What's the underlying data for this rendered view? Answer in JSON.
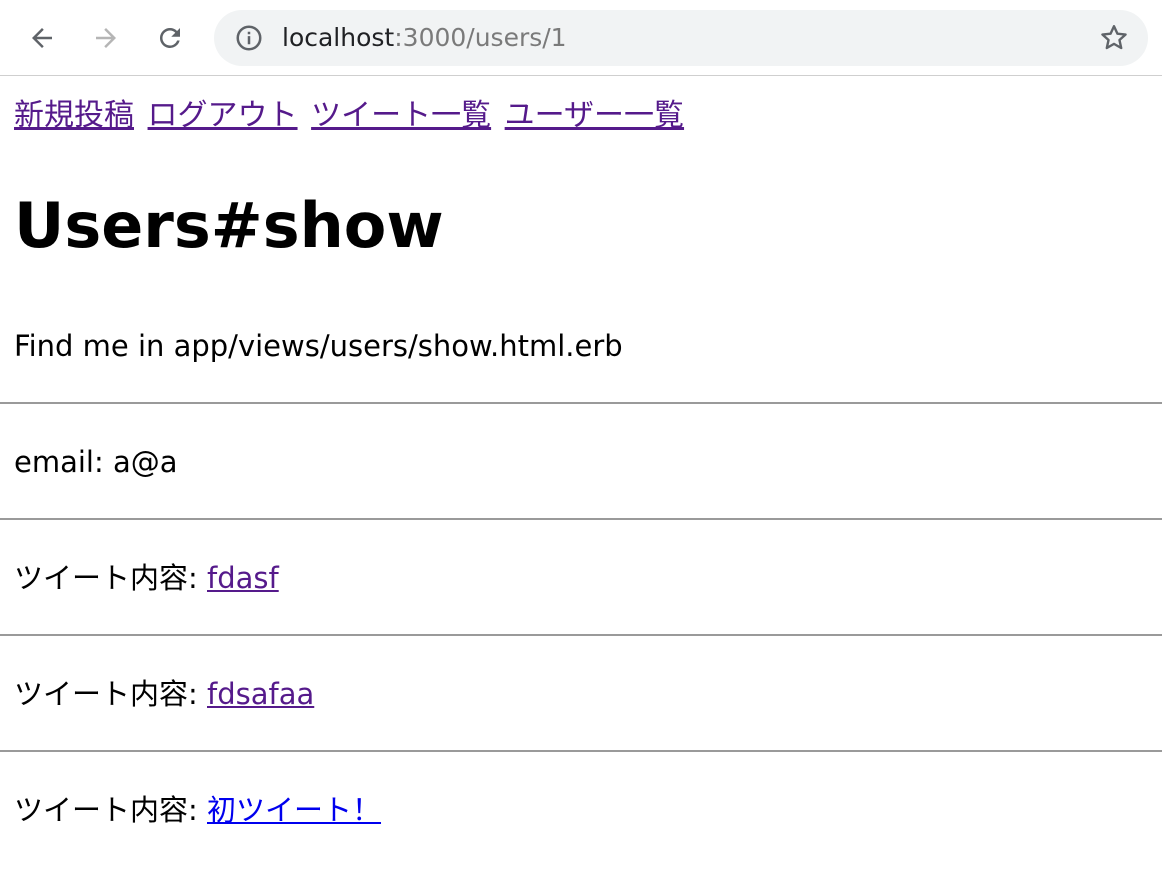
{
  "browser": {
    "url_host": "localhost",
    "url_path": ":3000/users/1"
  },
  "nav": {
    "links": [
      "新規投稿",
      "ログアウト",
      "ツイート一覧",
      "ユーザー一覧"
    ]
  },
  "main": {
    "title": "Users#show",
    "template_note": "Find me in app/views/users/show.html.erb",
    "email_line": "email: a@a",
    "tweet_label": "ツイート内容: ",
    "tweets": [
      "fdasf",
      "fdsafaa",
      "初ツイート！"
    ]
  },
  "colors": {
    "visited_link": "#551a8b",
    "unvisited_link": "#0000ee",
    "omnibox_bg": "#f1f3f4"
  },
  "icons": {
    "back": "arrow-left-icon",
    "forward": "arrow-right-icon",
    "reload": "reload-icon",
    "site_info": "info-icon",
    "bookmark": "star-icon"
  }
}
